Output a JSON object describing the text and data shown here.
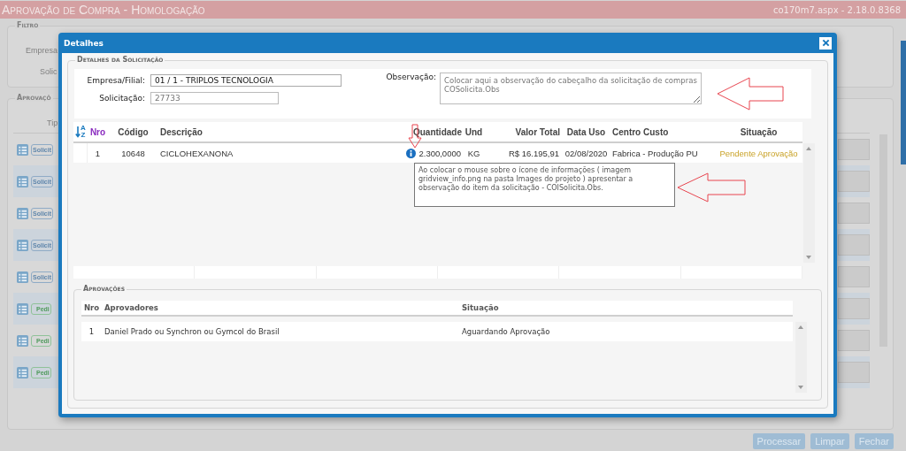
{
  "app_header": {
    "title": "Aprovação de Compra  - Homologação",
    "page_info": "co170m7.aspx - 2.18.0.8368"
  },
  "background": {
    "filter": {
      "legend": "Filtro",
      "labels": [
        "Empresa",
        "Solic"
      ]
    },
    "approvals": {
      "legend": "Aprovaçõ",
      "column": "Tip",
      "rows": [
        {
          "kind": "solicitacao",
          "tag": "Solicit"
        },
        {
          "kind": "solicitacao",
          "tag": "Solicit"
        },
        {
          "kind": "solicitacao",
          "tag": "Solicit"
        },
        {
          "kind": "solicitacao",
          "tag": "Solicit"
        },
        {
          "kind": "solicitacao",
          "tag": "Solicit"
        },
        {
          "kind": "pedido",
          "tag": "Pedi"
        },
        {
          "kind": "pedido",
          "tag": "Pedi"
        },
        {
          "kind": "pedido",
          "tag": "Pedi"
        }
      ]
    },
    "buttons": [
      "Processar",
      "Limpar",
      "Fechar"
    ]
  },
  "dialog": {
    "title": "Detalhes",
    "details": {
      "legend": "Detalhes da Solicitação",
      "company_label": "Empresa/Filial:",
      "company_value": "01 / 1 - TRIPLOS TECNOLOGIA",
      "request_label": "Solicitação:",
      "request_value": "27733",
      "note_label": "Observação:",
      "note_value": "Colocar aqui a observação do cabeçalho da solicitação de compras COSolicita.Obs"
    },
    "items_grid": {
      "sort_letters": [
        "A",
        "Z"
      ],
      "columns": [
        "Nro",
        "Código",
        "Descrição",
        "Quantidade",
        "Und",
        "Valor Total",
        "Data Uso",
        "Centro Custo",
        "Situação"
      ],
      "rows": [
        {
          "nro": "1",
          "code": "10648",
          "description": "CICLOHEXANONA",
          "quantity": "2.300,0000",
          "unit": "KG",
          "total": "R$ 16.195,91",
          "date": "02/08/2020",
          "cost_center": "Fabrica - Produção PU",
          "status": "Pendente Aprovação"
        }
      ]
    },
    "tooltip": "Ao colocar o mouse sobre o ícone de informações ( imagem gridview_info.png na pasta Images do projeto ) apresentar a observação do item da solicitação - COISolicita.Obs.",
    "approvals": {
      "legend": "Aprovações",
      "columns": [
        "Nro",
        "Aprovadores",
        "Situação"
      ],
      "rows": [
        {
          "nro": "1",
          "approvers": "Daniel Prado ou Synchron ou Gymcol do Brasil",
          "status": "Aguardando Aprovação"
        }
      ]
    }
  }
}
